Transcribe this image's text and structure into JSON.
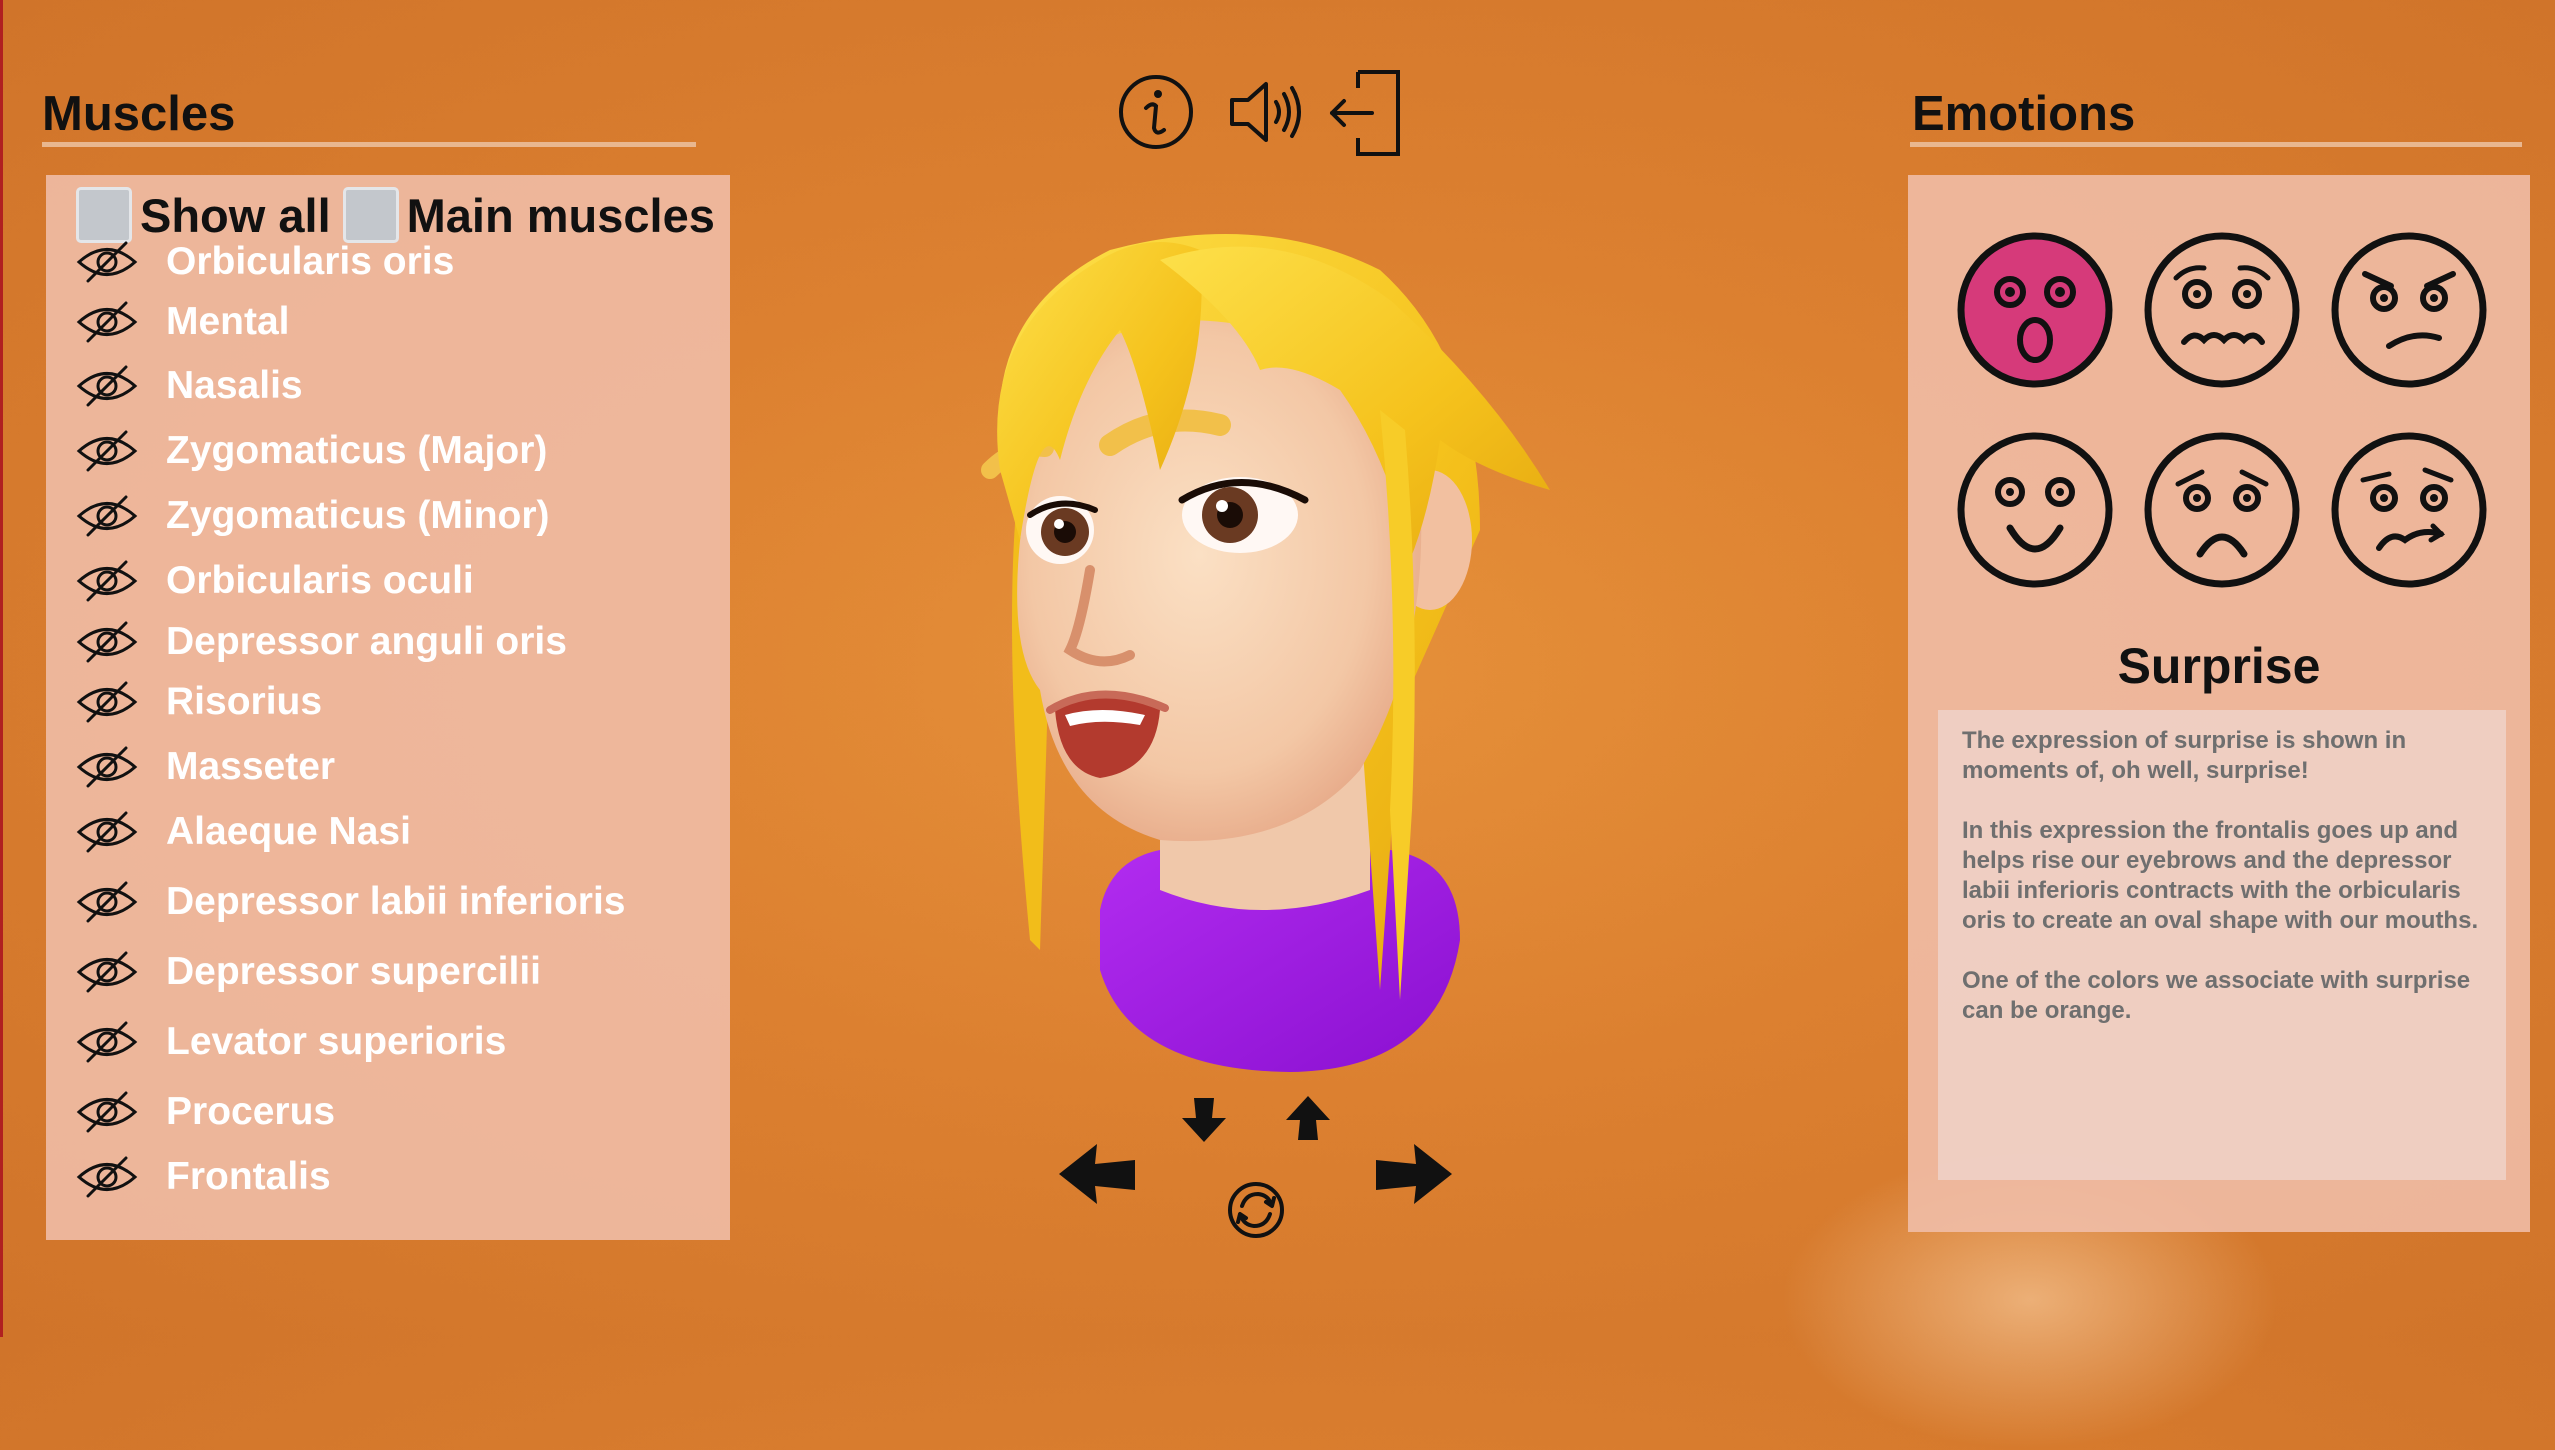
{
  "muscles": {
    "title": "Muscles",
    "show_all_label": "Show all",
    "main_muscles_label": "Main muscles",
    "items": [
      {
        "label": "Orbicularis oris"
      },
      {
        "label": "Mental"
      },
      {
        "label": "Nasalis"
      },
      {
        "label": "Zygomaticus (Major)"
      },
      {
        "label": "Zygomaticus (Minor)"
      },
      {
        "label": "Orbicularis oculi"
      },
      {
        "label": "Depressor anguli oris"
      },
      {
        "label": "Risorius"
      },
      {
        "label": "Masseter"
      },
      {
        "label": "Alaeque Nasi"
      },
      {
        "label": "Depressor labii inferioris"
      },
      {
        "label": "Depressor supercilii"
      },
      {
        "label": "Levator superioris"
      },
      {
        "label": "Procerus"
      },
      {
        "label": "Frontalis"
      }
    ]
  },
  "toolbar": {
    "info_icon": "info-icon",
    "sound_icon": "speaker-icon",
    "exit_icon": "exit-door-icon"
  },
  "emotions": {
    "title": "Emotions",
    "faces": [
      {
        "icon": "surprise-face-icon",
        "selected": true
      },
      {
        "icon": "fear-face-icon",
        "selected": false
      },
      {
        "icon": "anger-face-icon",
        "selected": false
      },
      {
        "icon": "happy-face-icon",
        "selected": false
      },
      {
        "icon": "sad-face-icon",
        "selected": false
      },
      {
        "icon": "disgust-face-icon",
        "selected": false
      }
    ],
    "selected_name": "Surprise",
    "description": [
      "The expression of surprise is shown in moments of, oh well, surprise!",
      "In this expression the frontalis goes up and helps rise our eyebrows and the depressor labii inferioris contracts with the orbicularis oris to create an oval shape with our mouths.",
      "One of the colors we associate with surprise can be orange."
    ]
  },
  "colors": {
    "background": "#dc8030",
    "panel": "#f0beaa",
    "selected_face": "#d63a7a",
    "hair": "#f5c21c",
    "shirt": "#9a18e0"
  }
}
